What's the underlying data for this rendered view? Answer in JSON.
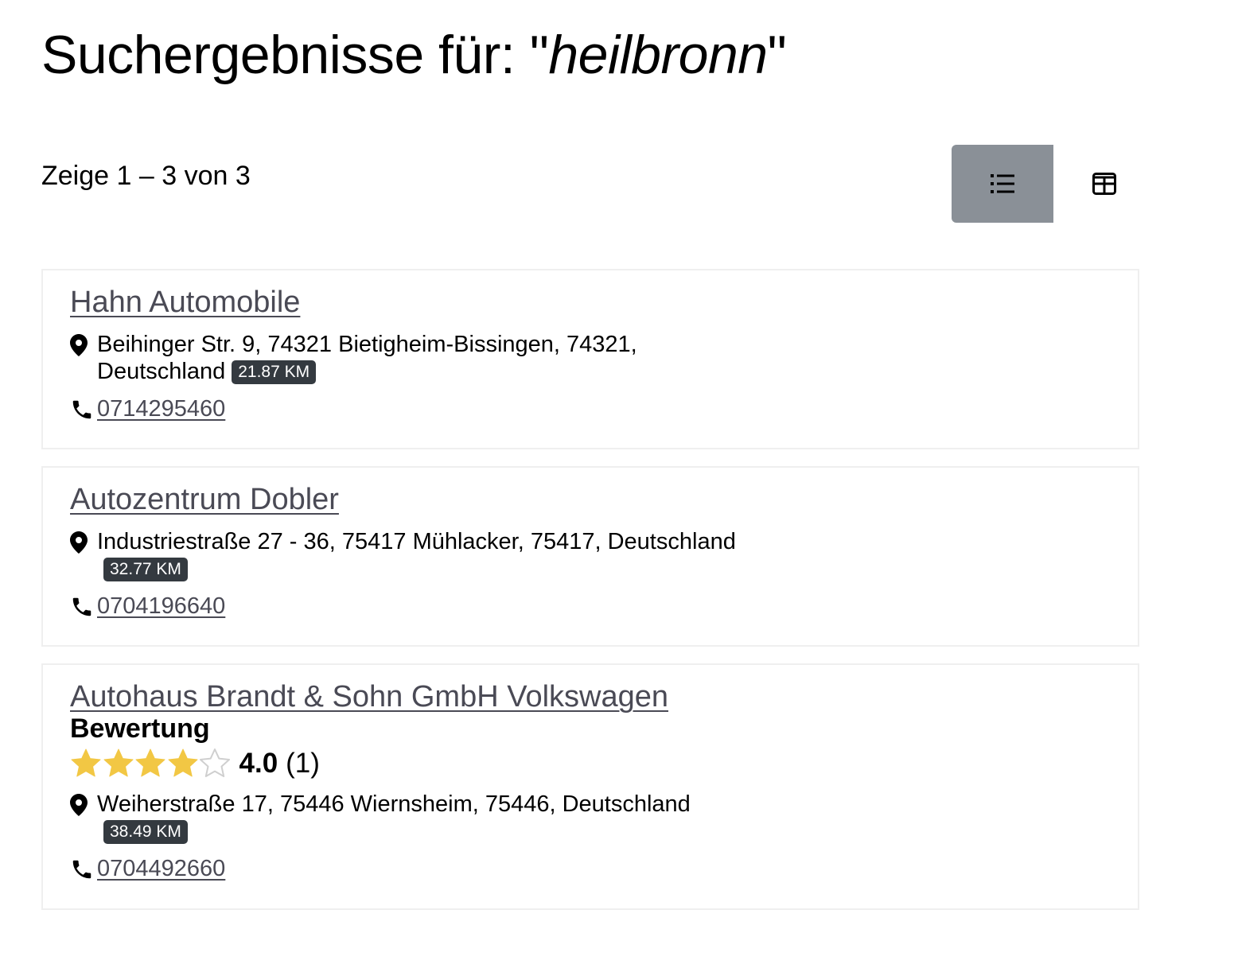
{
  "header": {
    "title_prefix": "Suchergebnisse für: \"",
    "query": "heilbronn",
    "title_suffix": "\""
  },
  "summary": {
    "count_text": "Zeige 1 – 3 von 3"
  },
  "view_toggle": {
    "list_icon": "list-icon",
    "grid_icon": "grid-icon",
    "active": "list"
  },
  "colors": {
    "badge_bg": "#343a40",
    "star_fill": "#f2c744",
    "active_toggle": "#8a9097"
  },
  "results": [
    {
      "name": "Hahn Automobile",
      "address_line1": "Beihinger Str. 9, 74321 Bietigheim-Bissingen, 74321,",
      "address_line2": "Deutschland",
      "distance": "21.87 KM",
      "phone": "0714295460"
    },
    {
      "name": "Autozentrum Dobler",
      "address_line1": "Industriestraße 27 - 36, 75417 Mühlacker, 75417, Deutschland",
      "distance": "32.77 KM",
      "phone": "0704196640"
    },
    {
      "name": "Autohaus Brandt & Sohn GmbH Volkswagen",
      "rating_label": "Bewertung",
      "rating_value": "4.0",
      "rating_count": "(1)",
      "stars_filled": 4,
      "stars_total": 5,
      "address_line1": "Weiherstraße 17, 75446 Wiernsheim, 75446, Deutschland",
      "distance": "38.49 KM",
      "phone": "0704492660"
    }
  ]
}
